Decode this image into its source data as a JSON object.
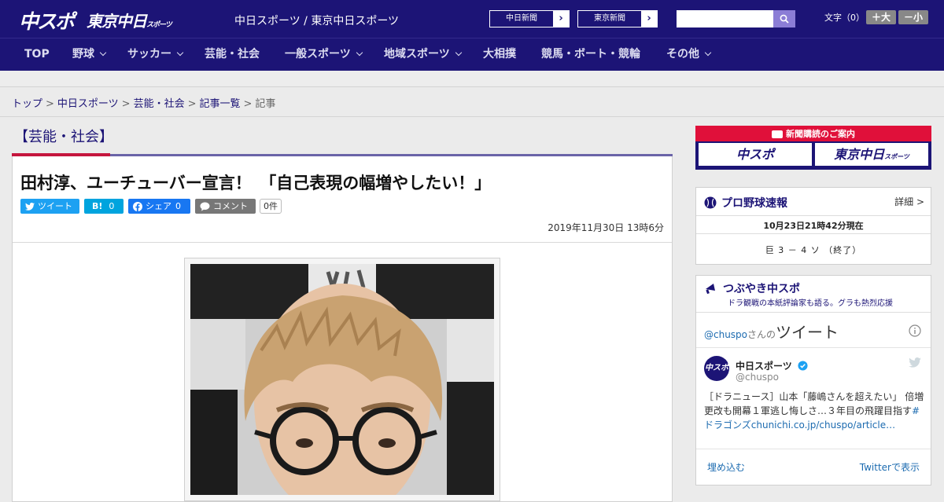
{
  "header": {
    "logo_main": "中スポ",
    "logo_sub": "東京中日",
    "logo_sub_small": "スポーツ",
    "site_name": "中日スポーツ / 東京中日スポーツ",
    "ext_links": [
      {
        "label": "中日新聞",
        "arrow": "›"
      },
      {
        "label": "東京新聞",
        "arrow": "›"
      }
    ],
    "search_placeholder": "",
    "fontsize_label": "文字（0）",
    "fontsize_up": "＋大",
    "fontsize_down": "－小"
  },
  "nav": {
    "items": [
      {
        "label": "TOP",
        "has_menu": false
      },
      {
        "label": "野球",
        "has_menu": true
      },
      {
        "label": "サッカー",
        "has_menu": true
      },
      {
        "label": "芸能・社会",
        "has_menu": false
      },
      {
        "label": "一般スポーツ",
        "has_menu": true
      },
      {
        "label": "地域スポーツ",
        "has_menu": true
      },
      {
        "label": "大相撲",
        "has_menu": false
      },
      {
        "label": "競馬・ボート・競輪",
        "has_menu": false
      },
      {
        "label": "その他",
        "has_menu": true
      }
    ]
  },
  "breadcrumb": {
    "items": [
      "トップ",
      "中日スポーツ",
      "芸能・社会",
      "記事一覧"
    ],
    "current": "記事",
    "separator": ">"
  },
  "article": {
    "category": "【芸能・社会】",
    "headline": "田村淳、ユーチューバー宣言！　「自己表現の幅増やしたい！」",
    "share": {
      "tweet": "ツイート",
      "hatena": "B!",
      "hatena_count": "0",
      "facebook": "シェア",
      "facebook_count": "0",
      "comment": "コメント",
      "comment_count": "0件"
    },
    "date": "2019年11月30日 13時6分"
  },
  "sidebar": {
    "subscribe": {
      "title": "新聞購読のご案内",
      "btn1": "中スポ",
      "btn2": "東京中日",
      "btn2_small": "スポーツ"
    },
    "baseball": {
      "title": "プロ野球速報",
      "detail": "詳細 >",
      "timestamp": "10月23日21時42分現在",
      "score": "巨 3 － 4 ソ （終了）"
    },
    "tsubuyaki": {
      "title": "つぶやき中スポ",
      "subtitle": "ドラ観戦の本紙評論家も語る。グラも熱烈応援"
    },
    "twitter": {
      "header_handle": "@chuspo",
      "header_san": "さんの",
      "header_tweet": "ツイート",
      "account_name": "中日スポーツ",
      "account_handle": "@chuspo",
      "tweet_text": "［ドラニュース］山本「藤嶋さんを超えたい」 倍増更改も開幕１軍逃し悔しさ…３年目の飛躍目指す",
      "tweet_tag": "#ドラゴンズ",
      "tweet_link": "chunichi.co.jp/chuspo/article…",
      "embed": "埋め込む",
      "view_on": "Twitterで表示"
    }
  },
  "colors": {
    "brand_navy": "#1c1476",
    "accent_red": "#c5153d",
    "twitter_blue": "#1da1f2",
    "hatena_blue": "#00a4de",
    "facebook_blue": "#1877f2"
  }
}
